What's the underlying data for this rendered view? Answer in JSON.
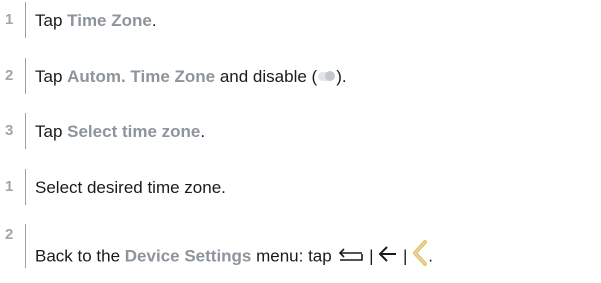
{
  "steps": [
    {
      "number": "1",
      "pre": "Tap ",
      "highlight": "Time Zone",
      "post": "."
    },
    {
      "number": "2",
      "pre": "Tap ",
      "highlight": "Autom. Time Zone",
      "mid": " and disable (",
      "post": ")."
    },
    {
      "number": "3",
      "pre": "Tap ",
      "highlight": "Select time zone",
      "post": "."
    },
    {
      "number": "1",
      "text": "Select desired time zone."
    },
    {
      "number": "2",
      "pre": "Back to the ",
      "highlight": "Device Settings",
      "mid": " menu: tap ",
      "separator": " | ",
      "post": "."
    }
  ],
  "icons": {
    "toggle": "toggle-off-icon",
    "return": "return-arrow-icon",
    "back_arrow": "left-arrow-icon",
    "back_chevron": "chevron-left-icon"
  },
  "colors": {
    "highlight": "#8d949b",
    "step_number": "#a0a6ad",
    "chevron_outer": "#f2c34a",
    "chevron_inner": "#c9d9e6"
  }
}
